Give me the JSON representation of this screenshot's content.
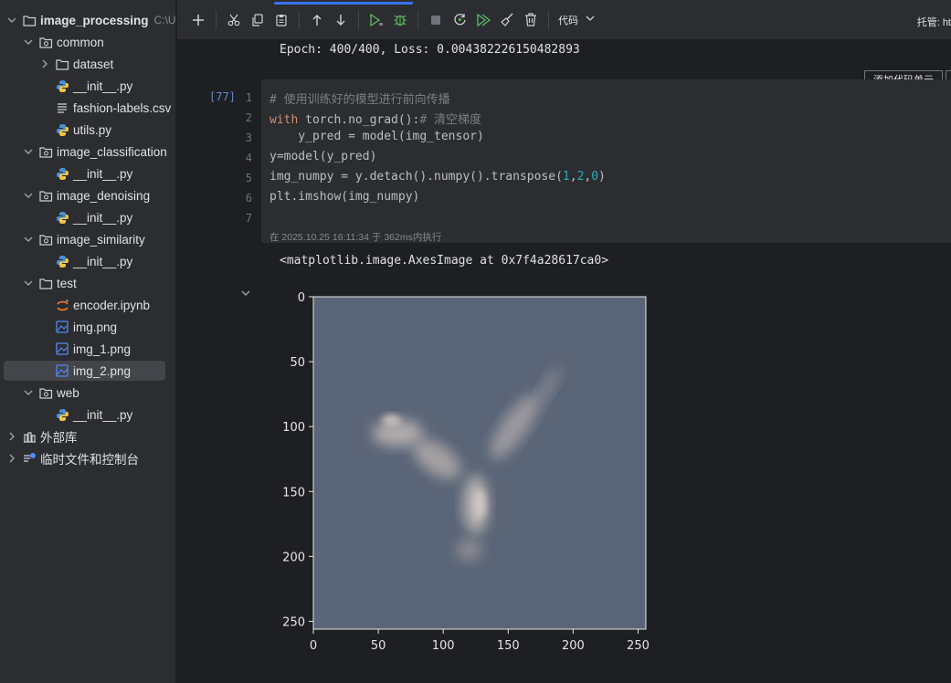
{
  "sidebar": {
    "root": {
      "label": "image_processing",
      "path": "C:\\U"
    },
    "items": [
      {
        "label": "common"
      },
      {
        "label": "dataset"
      },
      {
        "label": "__init__.py"
      },
      {
        "label": "fashion-labels.csv"
      },
      {
        "label": "utils.py"
      },
      {
        "label": "image_classification"
      },
      {
        "label": "__init__.py"
      },
      {
        "label": "image_denoising"
      },
      {
        "label": "__init__.py"
      },
      {
        "label": "image_similarity"
      },
      {
        "label": "__init__.py"
      },
      {
        "label": "test"
      },
      {
        "label": "encoder.ipynb"
      },
      {
        "label": "img.png"
      },
      {
        "label": "img_1.png"
      },
      {
        "label": "img_2.png"
      },
      {
        "label": "web"
      },
      {
        "label": "__init__.py"
      },
      {
        "label": "外部库"
      },
      {
        "label": "临时文件和控制台"
      }
    ]
  },
  "toolbar": {
    "code_select": "代码",
    "host_label": "托管: ht"
  },
  "notebook": {
    "prev_output": "Epoch: 400/400, Loss: 0.004382226150482893",
    "add_cell_label": "添加代码单元",
    "exec_count": "[77]",
    "line_numbers": [
      "1",
      "2",
      "3",
      "4",
      "5",
      "6",
      "7"
    ],
    "code": {
      "l1_comment": "# 使用训练好的模型进行前向传播",
      "l2_kw": "with",
      "l2_rest": " torch.no_grad():",
      "l2_comment": "# 清空梯度",
      "l3": "    y_pred = model(img_tensor)",
      "l4": "y=model(y_pred)",
      "l5_pre": "img_numpy = y.detach().numpy().transpose(",
      "l5_n1": "1",
      "l5_comma1": ",",
      "l5_n2": "2",
      "l5_comma2": ",",
      "l5_n3": "0",
      "l5_post": ")",
      "l6": "plt.imshow(img_numpy)"
    },
    "exec_info": "在 2025.10.25 16:11:34 于 362ms内执行",
    "output_text": "<matplotlib.image.AxesImage at 0x7f4a28617ca0>"
  },
  "chart_data": {
    "type": "image",
    "y_ticks": [
      "0",
      "50",
      "100",
      "150",
      "200",
      "250"
    ],
    "x_ticks": [
      "0",
      "50",
      "100",
      "150",
      "200",
      "250"
    ],
    "xlim": [
      0,
      256
    ],
    "ylim": [
      256,
      0
    ],
    "image_background": "#5a6577",
    "figure_background": "#1e1f22"
  },
  "colors": {
    "accent": "#3574f0",
    "keyword": "#cf8e6d",
    "number": "#2aacb8",
    "comment": "#7a7e85"
  }
}
